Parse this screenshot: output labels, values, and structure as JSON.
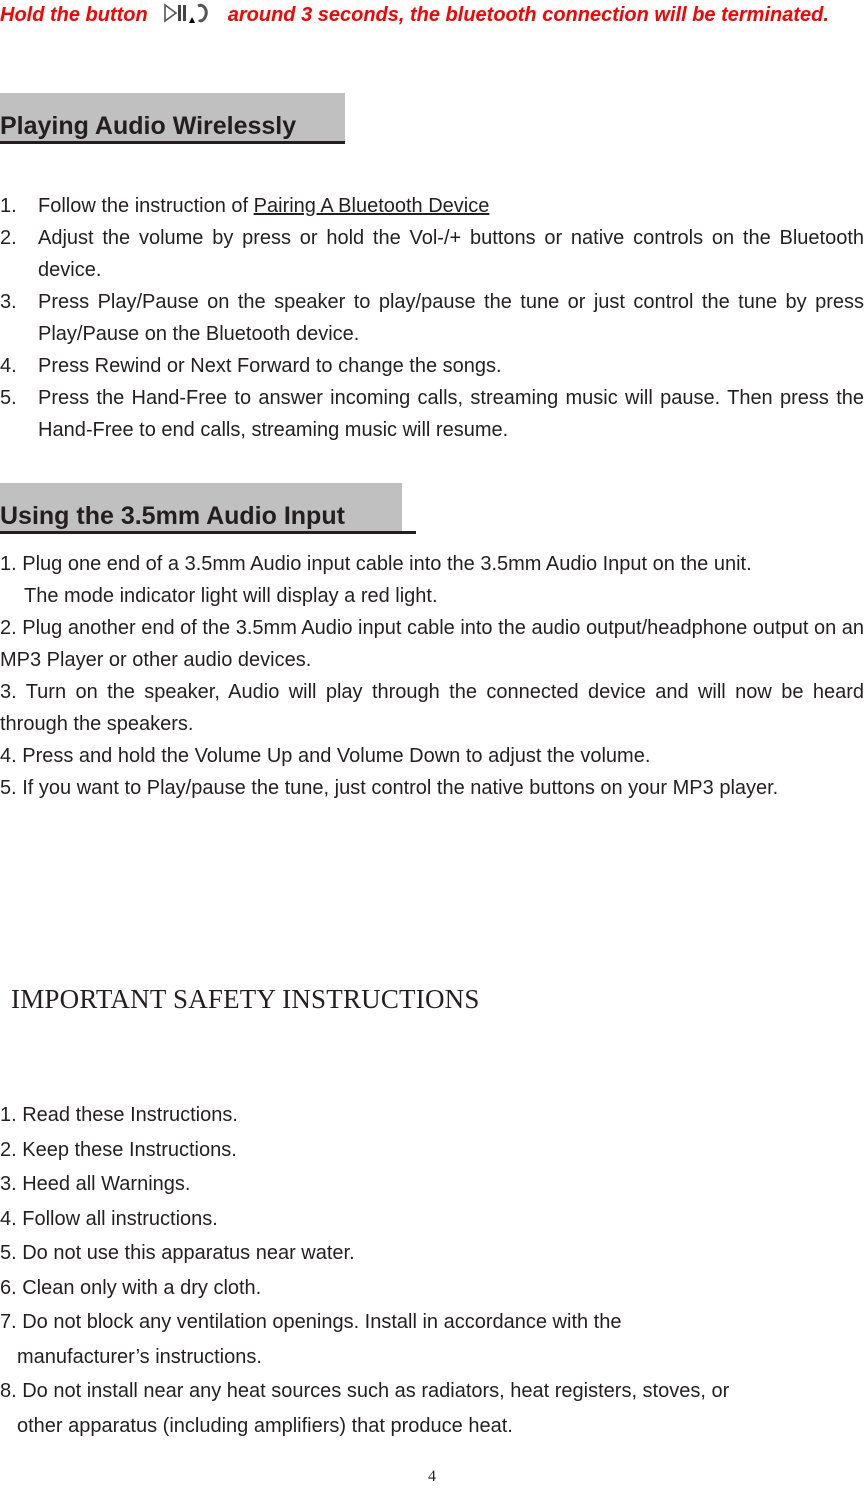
{
  "warning": {
    "text_before": "Hold the button",
    "icon": "play-pause-phone-icon",
    "text_after": "around 3 seconds, the bluetooth connection will be terminated.",
    "color": "#ff0000"
  },
  "sections": {
    "wireless": {
      "heading": "Playing Audio Wirelessly",
      "items": [
        {
          "num": "1.",
          "text": "Follow the instruction of ",
          "link": "Pairing A Bluetooth Device"
        },
        {
          "num": "2.",
          "text": "Adjust the volume by press or hold the Vol-/+ buttons or native controls on the Bluetooth device."
        },
        {
          "num": "3.",
          "text": "Press Play/Pause on the speaker to play/pause the tune or just control the tune by press Play/Pause on the Bluetooth device."
        },
        {
          "num": "4.",
          "text": "Press Rewind or Next Forward to change the songs."
        },
        {
          "num": "5.",
          "text": "Press the Hand-Free to answer incoming calls, streaming music will pause. Then press the Hand-Free to end calls, streaming music will resume."
        }
      ]
    },
    "audio_input": {
      "heading": "Using the 3.5mm Audio Input",
      "items": [
        "1. Plug one end of a 3.5mm Audio input cable into the 3.5mm Audio Input on the unit.",
        "The mode indicator light will display a red light.",
        "2. Plug another end of the 3.5mm Audio input cable into the audio output/headphone output on an MP3 Player or other audio devices.",
        "3. Turn on the speaker, Audio will play through the connected device and will now be heard through the speakers.",
        "4. Press and hold the Volume Up and Volume Down to adjust the volume.",
        "5. If you want to Play/pause the tune, just control the native buttons on your MP3 player."
      ]
    },
    "safety": {
      "heading": "IMPORTANT SAFETY INSTRUCTIONS",
      "items": [
        "1. Read these Instructions.",
        "2. Keep these Instructions.",
        "3. Heed all Warnings.",
        "4. Follow all instructions.",
        "5. Do not use this apparatus near water.",
        "6. Clean only with a dry cloth.",
        {
          "first": "7. Do not block any ventilation openings. Install in accordance with the",
          "cont": "manufacturer’s instructions."
        },
        {
          "first": "8. Do not install near any heat sources such as radiators, heat registers, stoves, or",
          "cont": "other apparatus (including amplifiers) that produce heat."
        }
      ]
    }
  },
  "page_number": "4"
}
